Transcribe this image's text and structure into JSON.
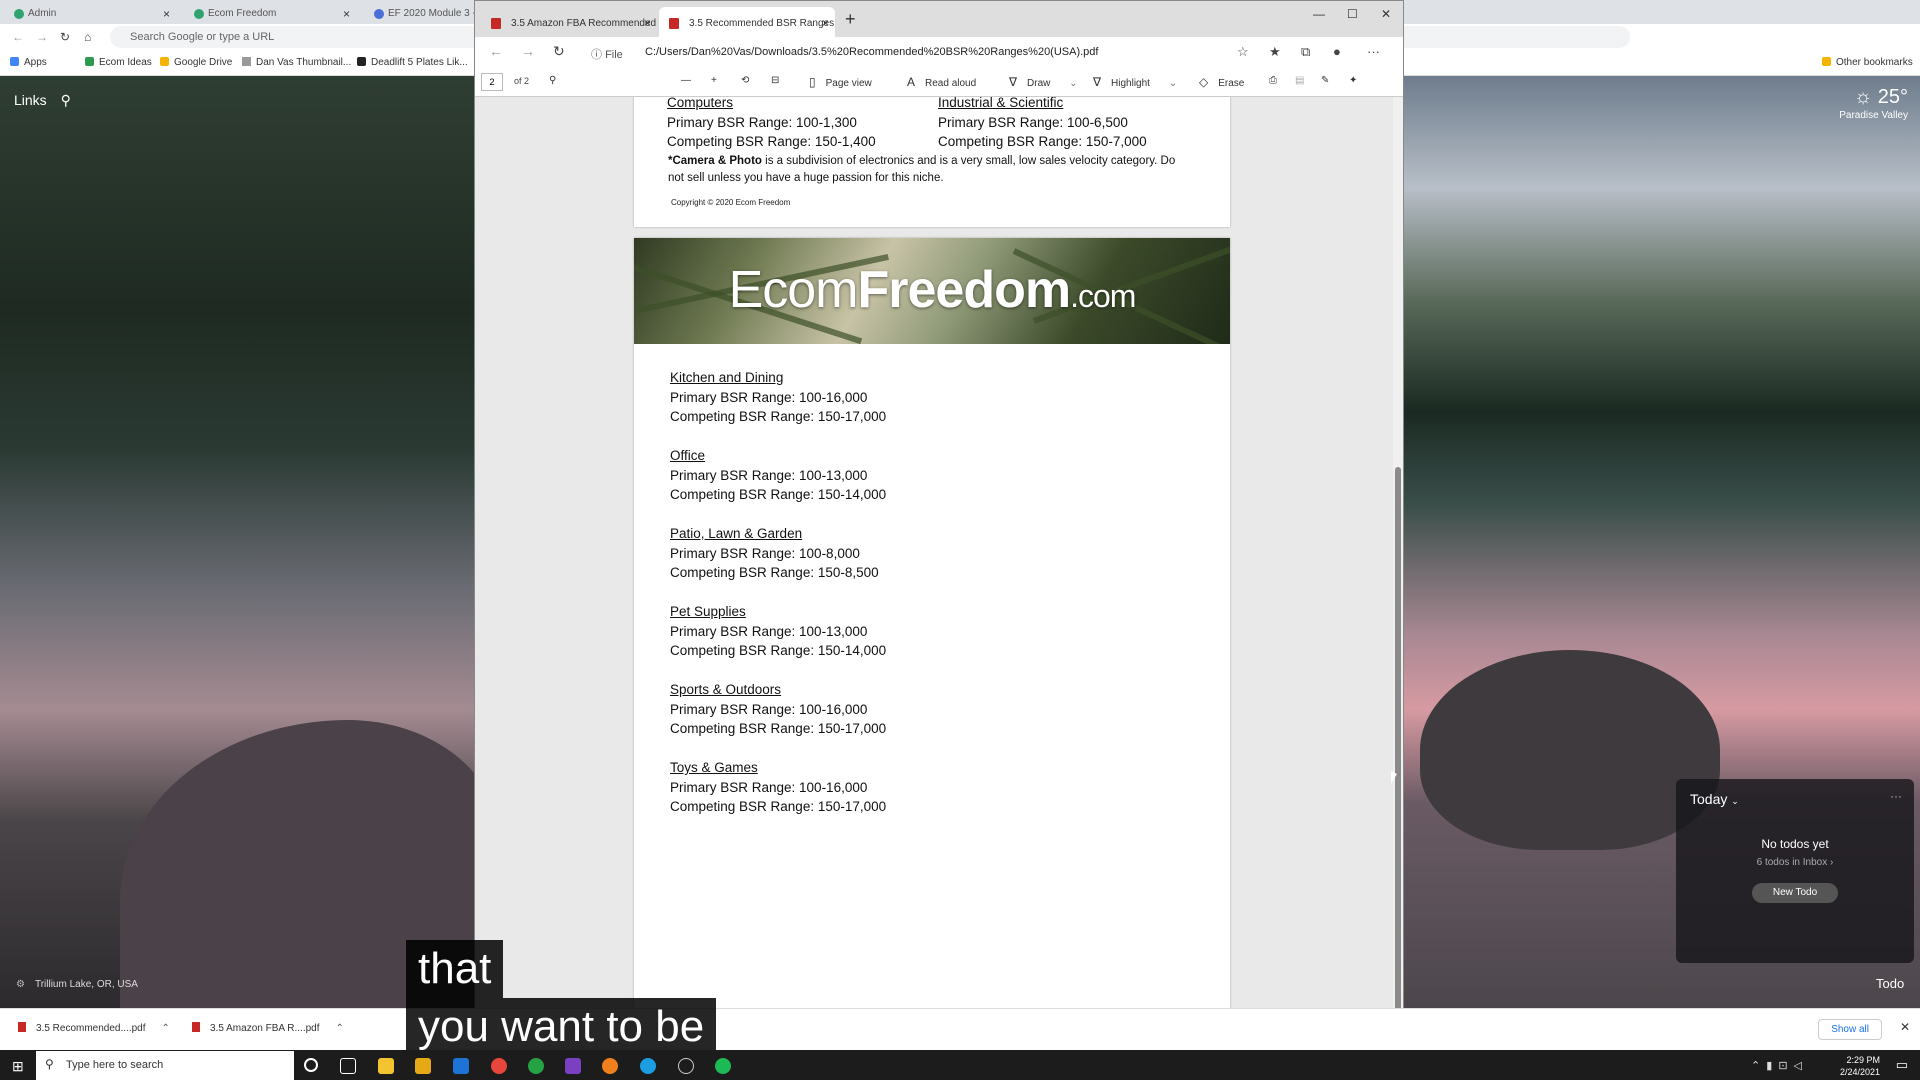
{
  "chrome": {
    "tabs": [
      "Admin",
      "Ecom Freedom",
      "EF 2020 Module 3 -"
    ],
    "omnibox_placeholder": "Search Google or type a URL",
    "bookmarks": [
      "Apps",
      "Ecom Ideas",
      "Google Drive",
      "Dan Vas Thumbnail...",
      "Deadlift 5 Plates Lik..."
    ],
    "other_bookmarks": "Other bookmarks"
  },
  "momentum": {
    "links": "Links",
    "temperature": "25°",
    "location": "Paradise Valley",
    "todo_header": "Today",
    "todo_empty": "No todos yet",
    "todo_inbox": "6 todos in Inbox",
    "todo_button": "New Todo",
    "todo_label": "Todo",
    "photo_credit": "Trillium Lake, OR, USA"
  },
  "edge": {
    "tabs": [
      "3.5 Amazon FBA Recommended",
      "3.5 Recommended BSR Ranges ("
    ],
    "file_label": "File",
    "url": "C:/Users/Dan%20Vas/Downloads/3.5%20Recommended%20BSR%20Ranges%20(USA).pdf",
    "page_number": "2",
    "page_of": "of 2",
    "tools": {
      "page_view": "Page view",
      "read_aloud": "Read aloud",
      "draw": "Draw",
      "highlight": "Highlight",
      "erase": "Erase"
    }
  },
  "pdf": {
    "page1": {
      "left_title": "Computers",
      "left_primary": "Primary BSR Range: 100-1,300",
      "left_competing": "Competing BSR Range: 150-1,400",
      "right_title": "Industrial & Scientific",
      "right_primary": "Primary BSR Range: 100-6,500",
      "right_competing": "Competing BSR Range: 150-7,000",
      "note_bold": "*Camera & Photo",
      "note_text": " is a subdivision of electronics and is a very small, low sales velocity category. Do not sell unless you have a huge passion for this niche.",
      "copyright": "Copyright © 2020 Ecom Freedom"
    },
    "banner": {
      "logo_thin": "Ecom",
      "logo_bold": "Freedom",
      "logo_com": ".com"
    },
    "categories": [
      {
        "title": "Kitchen and Dining",
        "primary": "Primary BSR Range: 100-16,000",
        "competing": "Competing BSR Range: 150-17,000"
      },
      {
        "title": "Office",
        "primary": "Primary BSR Range: 100-13,000",
        "competing": "Competing BSR Range: 150-14,000"
      },
      {
        "title": "Patio, Lawn & Garden",
        "primary": "Primary BSR Range: 100-8,000",
        "competing": "Competing BSR Range: 150-8,500"
      },
      {
        "title": "Pet Supplies",
        "primary": "Primary BSR Range: 100-13,000",
        "competing": "Competing BSR Range: 150-14,000"
      },
      {
        "title": "Sports & Outdoors",
        "primary": "Primary BSR Range: 100-16,000",
        "competing": "Competing BSR Range: 150-17,000"
      },
      {
        "title": "Toys & Games",
        "primary": "Primary BSR Range: 100-16,000",
        "competing": "Competing BSR Range: 150-17,000"
      }
    ]
  },
  "downloads": {
    "items": [
      "3.5 Recommended....pdf",
      "3.5 Amazon FBA R....pdf"
    ],
    "show_all": "Show all"
  },
  "taskbar": {
    "search_placeholder": "Type here to search",
    "time": "2:29 PM",
    "date": "2/24/2021"
  },
  "subtitles": [
    "that",
    "you want to be"
  ]
}
